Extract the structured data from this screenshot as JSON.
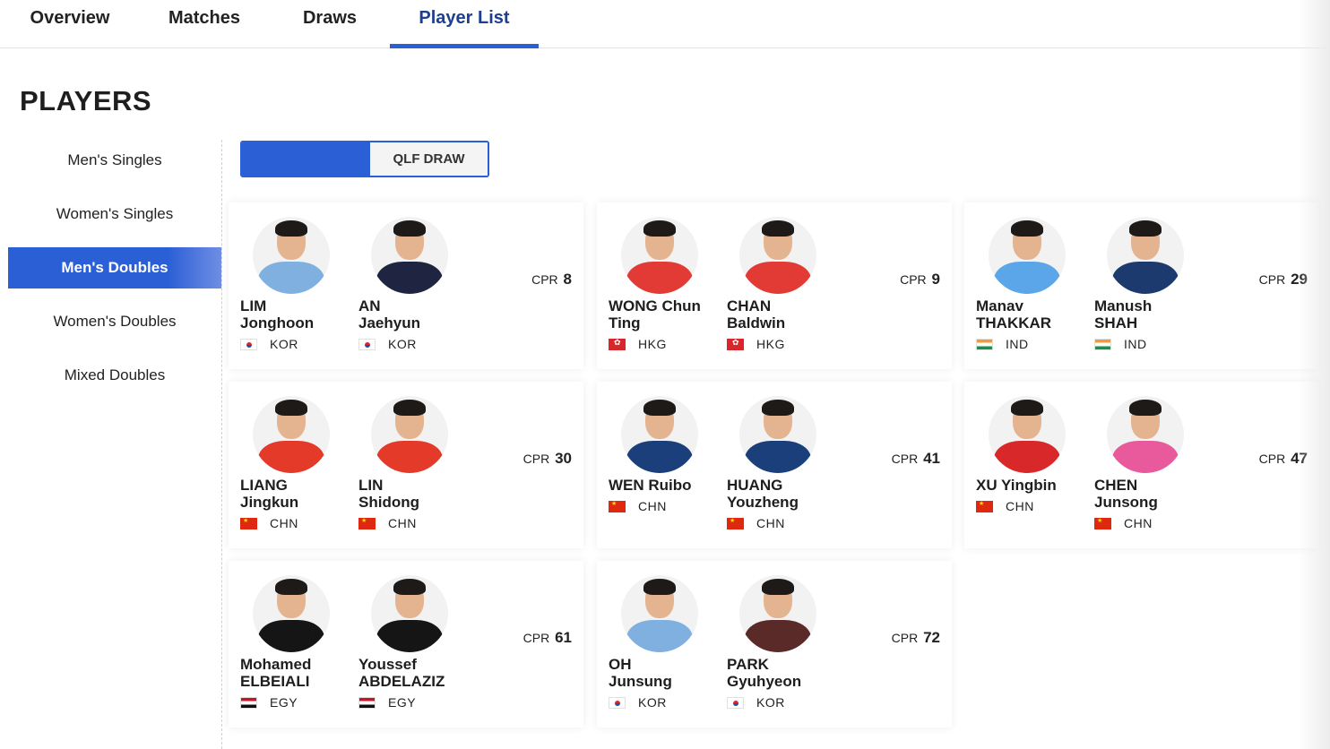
{
  "tabs": [
    "Overview",
    "Matches",
    "Draws",
    "Player List"
  ],
  "page_title": "PLAYERS",
  "sidebar": [
    "Men's Singles",
    "Women's Singles",
    "Men's Doubles",
    "Women's Doubles",
    "Mixed Doubles"
  ],
  "sidebar_active": "Men's Doubles",
  "toggle": {
    "option_a": "",
    "option_b": "QLF DRAW"
  },
  "cpr_label": "CPR",
  "colors": {
    "accent": "#2b5fd6"
  },
  "pairs": [
    {
      "cpr": "8",
      "players": [
        {
          "name_line1": "LIM",
          "name_line2": "Jonghoon",
          "country": "KOR",
          "flag": "kor",
          "jersey": "#7fb0e0"
        },
        {
          "name_line1": "AN",
          "name_line2": "Jaehyun",
          "country": "KOR",
          "flag": "kor",
          "jersey": "#1f2540"
        }
      ]
    },
    {
      "cpr": "9",
      "players": [
        {
          "name_line1": "WONG Chun",
          "name_line2": "Ting",
          "country": "HKG",
          "flag": "hkg",
          "jersey": "#e23a34"
        },
        {
          "name_line1": "CHAN",
          "name_line2": "Baldwin",
          "country": "HKG",
          "flag": "hkg",
          "jersey": "#e23a34"
        }
      ]
    },
    {
      "cpr": "29",
      "players": [
        {
          "name_line1": "Manav",
          "name_line2": "THAKKAR",
          "country": "IND",
          "flag": "ind",
          "jersey": "#5ba6e8"
        },
        {
          "name_line1": "Manush",
          "name_line2": "SHAH",
          "country": "IND",
          "flag": "ind",
          "jersey": "#1c3a6e"
        }
      ]
    },
    {
      "cpr": "30",
      "players": [
        {
          "name_line1": "LIANG",
          "name_line2": "Jingkun",
          "country": "CHN",
          "flag": "chn",
          "jersey": "#e33a2a"
        },
        {
          "name_line1": "LIN",
          "name_line2": "Shidong",
          "country": "CHN",
          "flag": "chn",
          "jersey": "#e33a2a"
        }
      ]
    },
    {
      "cpr": "41",
      "players": [
        {
          "name_line1": "WEN Ruibo",
          "name_line2": "",
          "country": "CHN",
          "flag": "chn",
          "jersey": "#1b3f7a"
        },
        {
          "name_line1": "HUANG",
          "name_line2": "Youzheng",
          "country": "CHN",
          "flag": "chn",
          "jersey": "#1b3f7a"
        }
      ]
    },
    {
      "cpr": "47",
      "players": [
        {
          "name_line1": "XU Yingbin",
          "name_line2": "",
          "country": "CHN",
          "flag": "chn",
          "jersey": "#d9282a"
        },
        {
          "name_line1": "CHEN",
          "name_line2": "Junsong",
          "country": "CHN",
          "flag": "chn",
          "jersey": "#e85a9c"
        }
      ]
    },
    {
      "cpr": "61",
      "players": [
        {
          "name_line1": "Mohamed",
          "name_line2": "ELBEIALI",
          "country": "EGY",
          "flag": "egy",
          "jersey": "#151515"
        },
        {
          "name_line1": "Youssef",
          "name_line2": "ABDELAZIZ",
          "country": "EGY",
          "flag": "egy",
          "jersey": "#151515"
        }
      ]
    },
    {
      "cpr": "72",
      "players": [
        {
          "name_line1": "OH",
          "name_line2": "Junsung",
          "country": "KOR",
          "flag": "kor",
          "jersey": "#7fb0e0"
        },
        {
          "name_line1": "PARK",
          "name_line2": "Gyuhyeon",
          "country": "KOR",
          "flag": "kor",
          "jersey": "#5a2a28"
        }
      ]
    }
  ]
}
